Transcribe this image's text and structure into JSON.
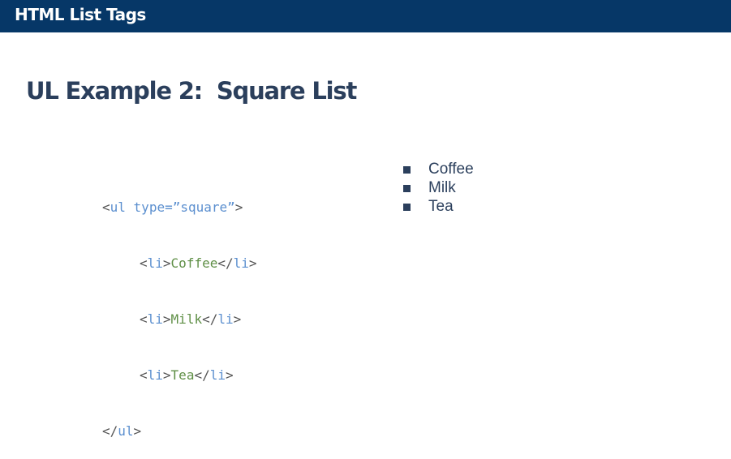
{
  "header": {
    "title": "HTML List Tags"
  },
  "slide": {
    "title": "UL Example 2:  Square List"
  },
  "code": {
    "open_lt": "<",
    "open_tag": "ul",
    "attr": "type=",
    "attr_value": "”square”",
    "open_gt": ">",
    "items": [
      {
        "lt": "<",
        "tag": "li",
        "gt": ">",
        "text": "Coffee",
        "close_lt": "</",
        "close_tag": "li",
        "close_gt": ">"
      },
      {
        "lt": "<",
        "tag": "li",
        "gt": ">",
        "text": "Milk",
        "close_lt": "</",
        "close_tag": "li",
        "close_gt": ">"
      },
      {
        "lt": "<",
        "tag": "li",
        "gt": ">",
        "text": "Tea",
        "close_lt": "</",
        "close_tag": "li",
        "close_gt": ">"
      }
    ],
    "close_lt": "</",
    "close_tag": "ul",
    "close_gt": ">"
  },
  "rendered_list": {
    "items": [
      "Coffee",
      "Milk",
      "Tea"
    ]
  },
  "colors": {
    "header_bg": "#063767",
    "title": "#2b3f5c",
    "code_tag": "#5b8fcf",
    "code_text": "#5f8f46"
  }
}
